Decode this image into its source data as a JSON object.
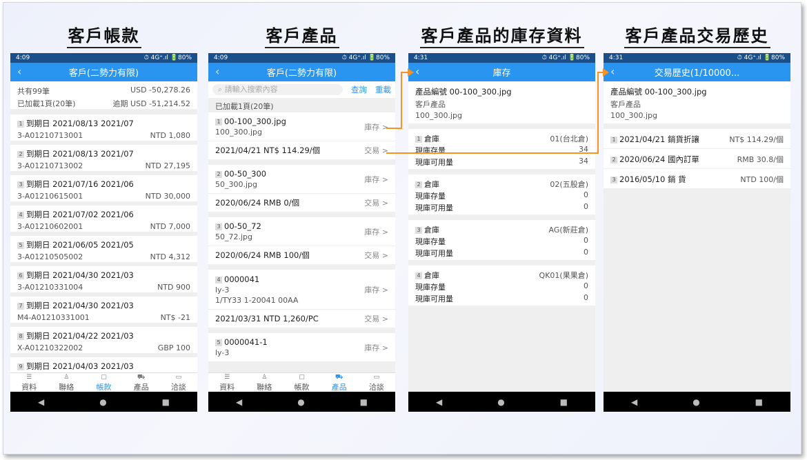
{
  "panels": [
    {
      "title": "客戶帳款"
    },
    {
      "title": "客戶產品"
    },
    {
      "title": "客戶產品的庫存資料"
    },
    {
      "title": "客戶產品交易歷史"
    }
  ],
  "phones": {
    "p1": {
      "status_time": "4:09",
      "status_right": "⏱ 4G⁺.ıl 🔋80%",
      "title": "客戶(二勢力有限)",
      "summary": {
        "count": "共有99筆",
        "total": "USD -50,278.26",
        "loaded": "已加載1頁(20筆)",
        "overdue": "逾期 USD -51,214.52"
      },
      "items": [
        {
          "no": "1",
          "line1": "到期日 2021/08/13 2021/07",
          "code": "3-A01210713001",
          "amount": "NTD 1,080"
        },
        {
          "no": "2",
          "line1": "到期日 2021/08/13 2021/07",
          "code": "3-A01210713002",
          "amount": "NTD 27,195"
        },
        {
          "no": "3",
          "line1": "到期日 2021/07/16 2021/06",
          "code": "3-A01210615001",
          "amount": "NTD 30,000"
        },
        {
          "no": "4",
          "line1": "到期日 2021/07/02 2021/06",
          "code": "3-A01210602001",
          "amount": "NTD 7,000"
        },
        {
          "no": "5",
          "line1": "到期日 2021/06/05 2021/05",
          "code": "3-A01210505002",
          "amount": "NTD 4,312"
        },
        {
          "no": "6",
          "line1": "到期日 2021/04/30 2021/03",
          "code": "3-A01210331004",
          "amount": "NTD 900"
        },
        {
          "no": "7",
          "line1": "到期日 2021/04/30 2021/03",
          "code": "M4-A01210331001",
          "amount": "NT$ -21"
        },
        {
          "no": "8",
          "line1": "到期日 2021/04/22 2021/03",
          "code": "X-A01210322002",
          "amount": "GBP 100"
        },
        {
          "no": "9",
          "line1": "到期日 2021/04/03 2021/03",
          "code": "",
          "amount": ""
        }
      ]
    },
    "p2": {
      "status_time": "4:09",
      "status_right": "⏱ 4G⁺.ıl 🔋80%",
      "title": "客戶(二勢力有限)",
      "search_placeholder": "請輸入搜索內容",
      "query_label": "查詢",
      "reset_label": "重載",
      "loaded": "已加載1頁(20筆)",
      "inventory_label": "庫存 >",
      "trade_label": "交易 >",
      "products": [
        {
          "no": "1",
          "name": "00-100_300.jpg",
          "sub": "100_300.jpg",
          "sub2": "",
          "trade": "2021/04/21 NT$ 114.29/個"
        },
        {
          "no": "2",
          "name": "00-50_300",
          "sub": "50_300.jpg",
          "sub2": "",
          "trade": "2020/06/24 RMB 0/個"
        },
        {
          "no": "3",
          "name": "00-50_72",
          "sub": "50_72.jpg",
          "sub2": "",
          "trade": "2020/06/24 RMB 100/個"
        },
        {
          "no": "4",
          "name": "0000041",
          "sub": "ly-3",
          "sub2": "1/TY33 1-20041 00AA",
          "trade": "2021/03/31 NTD 1,260/PC"
        },
        {
          "no": "5",
          "name": "0000041-1",
          "sub": "ly-3",
          "sub2": "",
          "trade": ""
        }
      ]
    },
    "p3": {
      "status_time": "4:31",
      "status_right": "⏱ 4G⁺.ıl 🔋80%",
      "title": "庫存",
      "product_no": "產品編號 00-100_300.jpg",
      "product_label": "客戶產品",
      "product_sub": "100_300.jpg",
      "warehouse_label": "倉庫",
      "stock_label": "現庫存量",
      "avail_label": "現庫可用量",
      "warehouses": [
        {
          "no": "1",
          "name": "01(台北倉)",
          "stock": "34",
          "avail": "34"
        },
        {
          "no": "2",
          "name": "02(五股倉)",
          "stock": "0",
          "avail": "0"
        },
        {
          "no": "3",
          "name": "AG(新莊倉)",
          "stock": "0",
          "avail": "0"
        },
        {
          "no": "4",
          "name": "QK01(果果倉)",
          "stock": "0",
          "avail": "0"
        }
      ]
    },
    "p4": {
      "status_time": "4:31",
      "status_right": "⏱ 4G⁺.ıl 🔋80%",
      "title": "交易歷史(1/10000...",
      "product_no": "產品編號 00-100_300.jpg",
      "product_label": "客戶產品",
      "product_sub": "100_300.jpg",
      "history": [
        {
          "no": "1",
          "desc": "2021/04/21 銷貨折讓",
          "price": "NT$ 114.29/個"
        },
        {
          "no": "2",
          "desc": "2020/06/24 國內訂單",
          "price": "RMB 30.8/個"
        },
        {
          "no": "3",
          "desc": "2016/05/10 銷 貨",
          "price": "NTD 100/個"
        }
      ]
    }
  },
  "bottom_nav": [
    {
      "label": "資料",
      "icon": "list-icon"
    },
    {
      "label": "聯絡",
      "icon": "contact-icon"
    },
    {
      "label": "帳款",
      "icon": "calendar-icon"
    },
    {
      "label": "產品",
      "icon": "cart-icon"
    },
    {
      "label": "洽談",
      "icon": "chat-icon"
    }
  ],
  "system_nav": {
    "back": "◀",
    "home": "●",
    "recent": "■"
  },
  "colors": {
    "header": "#2a95f0",
    "statusbar": "#1b4f8a",
    "accent_arrow": "#f7931e"
  }
}
